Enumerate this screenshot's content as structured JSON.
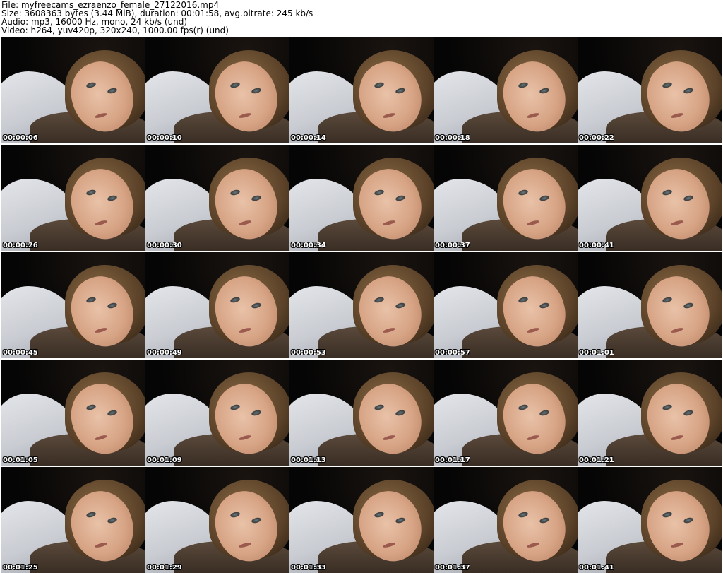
{
  "header": {
    "file_line": "File: myfreecams_ezraenzo_female_27122016.mp4",
    "size_line": "Size: 3608363 bytes (3.44 MiB), duration: 00:01:58, avg.bitrate: 245 kb/s",
    "audio_line": "Audio: mp3, 16000 Hz, mono, 24 kb/s (und)",
    "video_line": "Video: h264, yuv420p, 320x240, 1000.00 fps(r) (und)"
  },
  "thumbnails": [
    {
      "timestamp": "00:00:06"
    },
    {
      "timestamp": "00:00:10"
    },
    {
      "timestamp": "00:00:14"
    },
    {
      "timestamp": "00:00:18"
    },
    {
      "timestamp": "00:00:22"
    },
    {
      "timestamp": "00:00:26"
    },
    {
      "timestamp": "00:00:30"
    },
    {
      "timestamp": "00:00:34"
    },
    {
      "timestamp": "00:00:37"
    },
    {
      "timestamp": "00:00:41"
    },
    {
      "timestamp": "00:00:45"
    },
    {
      "timestamp": "00:00:49"
    },
    {
      "timestamp": "00:00:53"
    },
    {
      "timestamp": "00:00:57"
    },
    {
      "timestamp": "00:01:01"
    },
    {
      "timestamp": "00:01:05"
    },
    {
      "timestamp": "00:01:09"
    },
    {
      "timestamp": "00:01:13"
    },
    {
      "timestamp": "00:01:17"
    },
    {
      "timestamp": "00:01:21"
    },
    {
      "timestamp": "00:01:25"
    },
    {
      "timestamp": "00:01:29"
    },
    {
      "timestamp": "00:01:33"
    },
    {
      "timestamp": "00:01:37"
    },
    {
      "timestamp": "00:01:41"
    }
  ]
}
